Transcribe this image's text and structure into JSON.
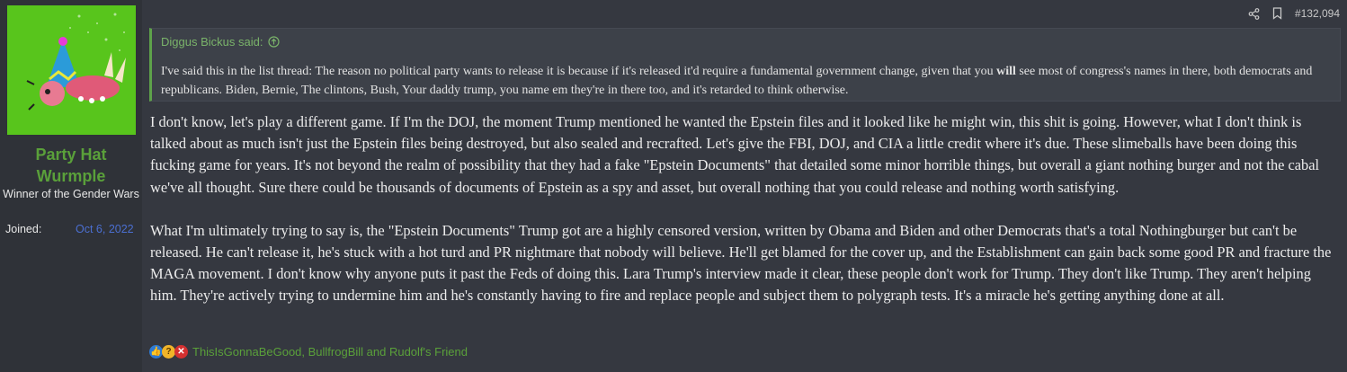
{
  "user": {
    "name": "Party Hat Wurmple",
    "title": "Winner of the Gender Wars",
    "joined_label": "Joined:",
    "joined_value": "Oct 6, 2022"
  },
  "post": {
    "number": "#132,094",
    "share_icon": "share-icon",
    "bookmark_icon": "bookmark-icon"
  },
  "quote": {
    "author": "Diggus Bickus said:",
    "text_before_bold": "I've said this in the list thread: The reason no political party wants to release it is because if it's released it'd require a fundamental government change, given that you ",
    "bold": "will",
    "text_after_bold": " see most of congress's names in there, both democrats and republicans. Biden, Bernie, The clintons, Bush, Your daddy trump, you name em they're in there too, and it's retarded to think otherwise."
  },
  "message": {
    "paragraphs": [
      "I don't know, let's play a different game. If I'm the DOJ, the moment Trump mentioned he wanted the Epstein files and it looked like he might win, this shit is going. However, what I don't think is talked about as much isn't just the Epstein files being destroyed, but also sealed and recrafted. Let's give the FBI, DOJ, and CIA a little credit where it's due. These slimeballs have been doing this fucking game for years. It's not beyond the realm of possibility that they had a fake \"Epstein Documents\" that detailed some minor horrible things, but overall a giant nothing burger and not the cabal we've all thought. Sure there could be thousands of documents of Epstein as a spy and asset, but overall nothing that you could release and nothing worth satisfying.",
      "What I'm ultimately trying to say is, the \"Epstein Documents\" Trump got are a highly censored version, written by Obama and Biden and other Democrats that's a total Nothingburger but can't be released. He can't release it, he's stuck with a hot turd and PR nightmare that nobody will believe. He'll get blamed for the cover up, and the Establishment can gain back some good PR and fracture the MAGA movement. I don't know why anyone puts it past the Feds of doing this. Lara Trump's interview made it clear, these people don't work for Trump. They don't like Trump. They aren't helping him. They're actively trying to undermine him and he's constantly having to fire and replace people and subject them to polygraph tests. It's a miracle he's getting anything done at all."
    ]
  },
  "reactions": {
    "icons": [
      "like-icon",
      "thinking-icon",
      "no-icon"
    ],
    "users": "ThisIsGonnaBeGood, BullfrogBill and Rudolf's Friend"
  },
  "colors": {
    "background": "#353840",
    "sidebar": "#2f3238",
    "accent_green": "#5aa03a",
    "link_blue": "#4b6fd1",
    "quote_bg": "#3d4149"
  }
}
